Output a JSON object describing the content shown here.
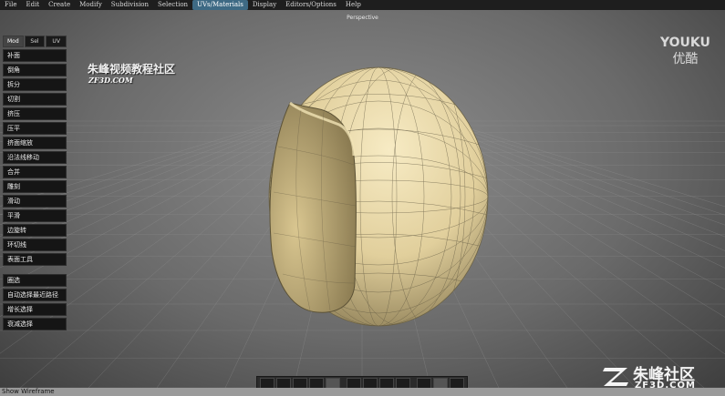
{
  "menubar": {
    "items": [
      "File",
      "Edit",
      "Create",
      "Modify",
      "Subdivision",
      "Selection",
      "UVs/Materials",
      "Display",
      "Editors/Options",
      "Help"
    ],
    "active_index": 6
  },
  "viewport": {
    "label": "Perspective"
  },
  "panel": {
    "tabs": [
      "Mod",
      "Sel",
      "UV"
    ],
    "active_tab": 0,
    "group1": [
      "补面",
      "倒角",
      "拆分",
      "切割",
      "挤压",
      "压平",
      "挤面缩放",
      "沿法线移动",
      "合并",
      "雕刻",
      "滑动",
      "平滑",
      "边旋转",
      "环切线",
      "表面工具"
    ],
    "group2": [
      "圈选",
      "自动选择最近路径",
      "增长选择",
      "衰减选择"
    ]
  },
  "watermark": {
    "title": "朱峰视频教程社区",
    "url": "ZF3D.COM",
    "youku_en": "YOUKU",
    "youku_cn": "优酷",
    "logo_cn": "朱峰社区",
    "logo_url": "ZF3D.COM"
  },
  "toolbar": {
    "buttons": [
      "view-front-icon",
      "view-side-icon",
      "view-top-icon",
      "view-perspective-icon",
      "view-iso-icon",
      "move-tool-icon",
      "rotate-tool-icon",
      "scale-tool-icon",
      "axis-tool-icon",
      "curve-tool-icon",
      "frame-tool-icon",
      "lasso-tool-icon"
    ]
  },
  "status": {
    "text": "Show Wireframe"
  },
  "colors": {
    "accent": "#3e6a84",
    "mesh": "#e7d7a8"
  }
}
